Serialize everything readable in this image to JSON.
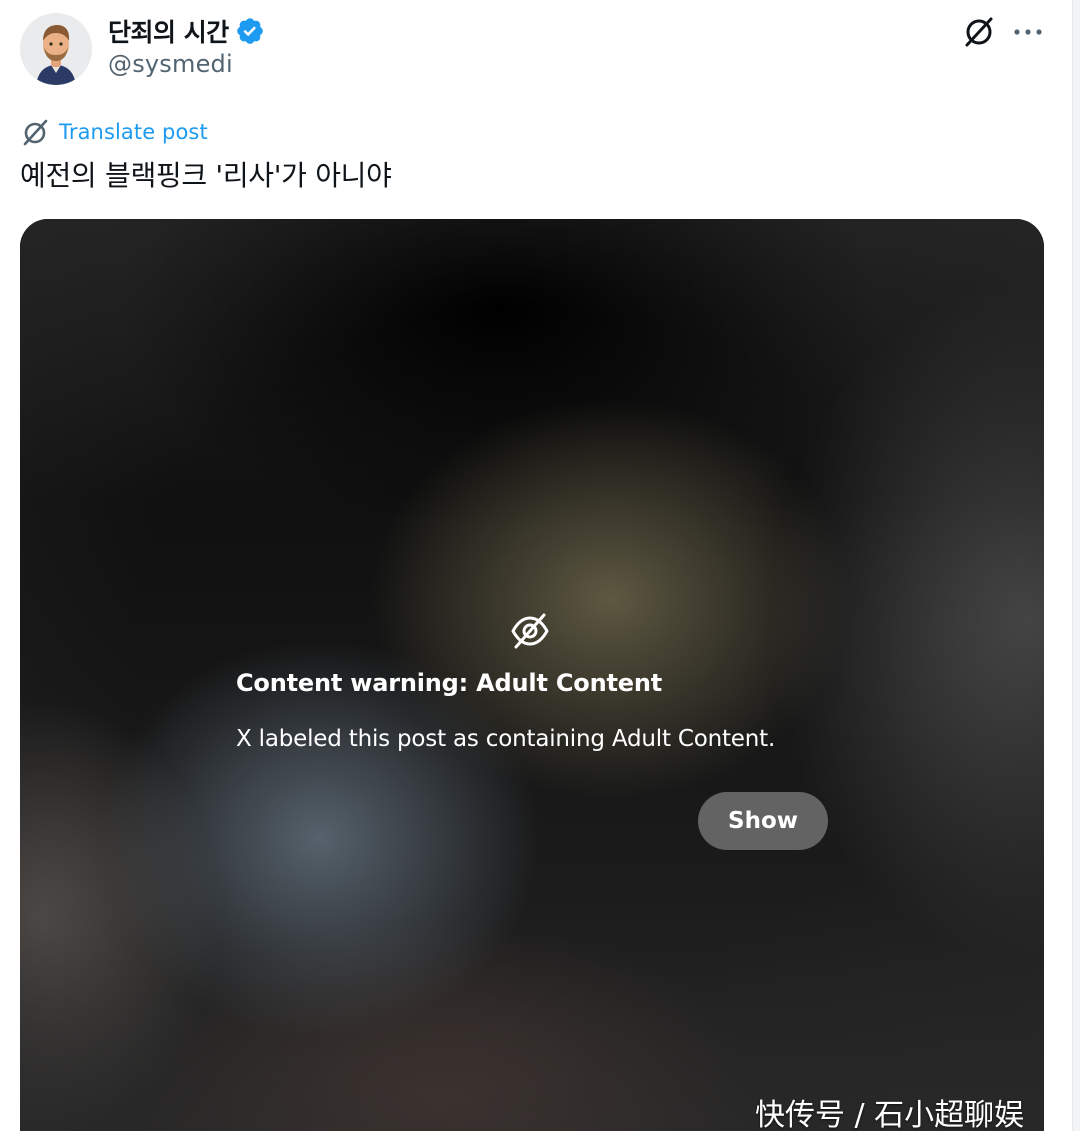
{
  "post": {
    "author": {
      "display_name": "단죄의 시간",
      "handle": "@sysmedi",
      "verified": true
    },
    "header_icons": {
      "grok": "grok-icon",
      "more": "more-icon"
    },
    "translate_label": "Translate post",
    "text": "예전의 블랙핑크 '리사'가 아니야"
  },
  "media": {
    "warning_icon": "eye-off-icon",
    "warning_title": "Content warning: Adult Content",
    "warning_body": "X labeled this post as containing Adult Content.",
    "show_label": "Show"
  },
  "watermark": "快传号 / 石小超聊娱",
  "colors": {
    "link_blue": "#1d9bf0",
    "verified_blue": "#1d9bf0",
    "text_primary": "#0f1419",
    "text_secondary": "#536471"
  }
}
